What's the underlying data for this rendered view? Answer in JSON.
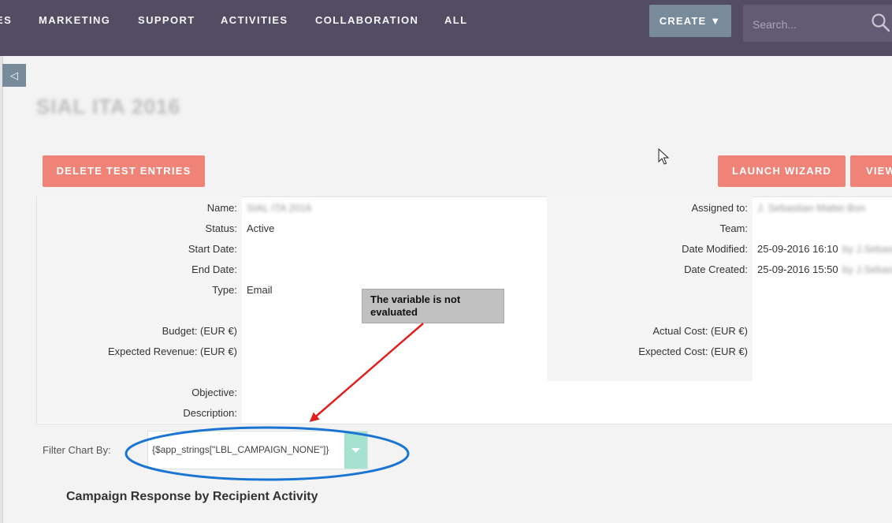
{
  "nav": {
    "items": [
      "ES",
      "MARKETING",
      "SUPPORT",
      "ACTIVITIES",
      "COLLABORATION",
      "ALL"
    ],
    "create_label": "CREATE ▼",
    "search_placeholder": "Search..."
  },
  "sidebar": {
    "toggle_glyph": "◁"
  },
  "record": {
    "title": "SIAL ITA 2016"
  },
  "actions": {
    "delete_test_entries": "DELETE TEST ENTRIES",
    "launch_wizard": "LAUNCH WIZARD",
    "view": "VIEW"
  },
  "details": {
    "left": [
      {
        "label": "Name:",
        "value": "SIAL ITA 2016"
      },
      {
        "label": "Status:",
        "value": "Active"
      },
      {
        "label": "Start Date:",
        "value": ""
      },
      {
        "label": "End Date:",
        "value": ""
      },
      {
        "label": "Type:",
        "value": "Email"
      },
      {
        "label": "Budget: (EUR €)",
        "value": ""
      },
      {
        "label": "Expected Revenue: (EUR €)",
        "value": ""
      },
      {
        "label": "Objective:",
        "value": ""
      },
      {
        "label": "Description:",
        "value": ""
      }
    ],
    "right": [
      {
        "label": "Assigned to:",
        "value": "J. Sebastian Mattei Bon"
      },
      {
        "label": "Team:",
        "value": ""
      },
      {
        "label": "Date Modified:",
        "value": "25-09-2016 16:10",
        "suffix": "by J.Sebastian"
      },
      {
        "label": "Date Created:",
        "value": "25-09-2016 15:50",
        "suffix": "by J.Sebastian"
      },
      {
        "label": "Actual Cost: (EUR €)",
        "value": ""
      },
      {
        "label": "Expected Cost: (EUR €)",
        "value": ""
      }
    ]
  },
  "filter": {
    "label": "Filter Chart By:",
    "selected": "{$app_strings[\"LBL_CAMPAIGN_NONE\"]}"
  },
  "chart": {
    "title": "Campaign Response by Recipient Activity"
  },
  "annotation": {
    "text": "The variable is not evaluated",
    "arrow_color": "#e0201e",
    "ellipse_color": "#1a74d2"
  },
  "colors": {
    "topbar": "#534d64",
    "salmon_button": "#f08377",
    "create_button": "#778b9b",
    "select_arrow": "#a5e2cf"
  }
}
